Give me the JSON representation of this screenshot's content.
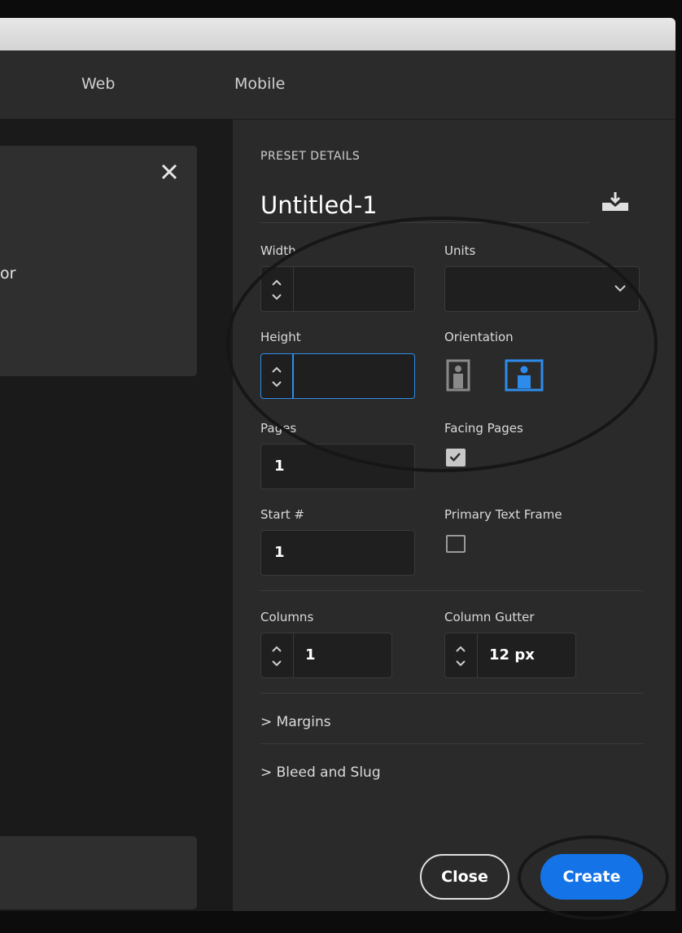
{
  "tabs": [
    {
      "label": "Web"
    },
    {
      "label": "Mobile"
    }
  ],
  "left_card": {
    "partial_text": "or"
  },
  "preset": {
    "section_title": "PRESET DETAILS",
    "doc_name": "Untitled-1",
    "width_label": "Width",
    "units_label": "Units",
    "height_label": "Height",
    "orientation_label": "Orientation",
    "orientation_selected": "landscape",
    "pages_label": "Pages",
    "pages_value": "1",
    "facing_pages_label": "Facing Pages",
    "facing_pages_checked": true,
    "start_label": "Start #",
    "start_value": "1",
    "primary_text_frame_label": "Primary Text Frame",
    "primary_text_frame_checked": false,
    "columns_label": "Columns",
    "columns_value": "1",
    "gutter_label": "Column Gutter",
    "gutter_value": "12 px",
    "margins_label": "> Margins",
    "bleed_label": "> Bleed and Slug"
  },
  "buttons": {
    "close": "Close",
    "create": "Create"
  },
  "colors": {
    "accent": "#1473e6",
    "focus": "#2d8ceb",
    "panel": "#2a2a2a"
  }
}
